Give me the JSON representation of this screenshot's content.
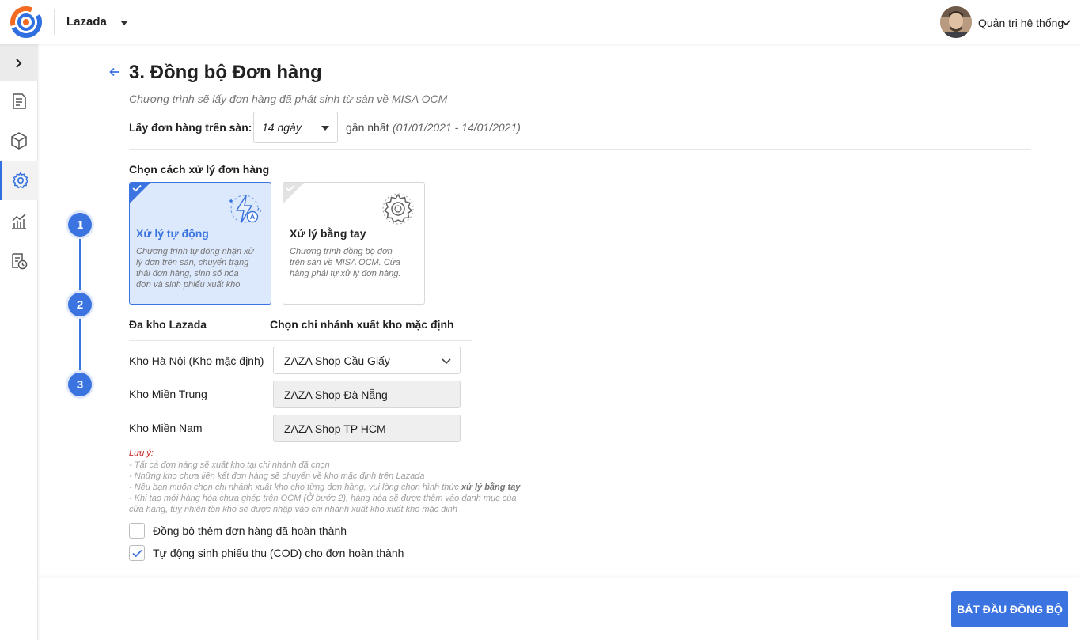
{
  "header": {
    "shop_name": "Lazada",
    "user_name": "Quản trị hệ thống",
    "icons": [
      "logo",
      "chevron-down-icon",
      "avatar"
    ]
  },
  "sidebar": {
    "items": [
      {
        "icon": "chevron-right-icon"
      },
      {
        "icon": "orders-icon"
      },
      {
        "icon": "product-box-icon"
      },
      {
        "icon": "gear-icon",
        "active": true
      },
      {
        "icon": "report-chart-icon"
      },
      {
        "icon": "history-icon"
      }
    ]
  },
  "page": {
    "title": "3. Đồng bộ Đơn hàng",
    "subtitle": "Chương trình sẽ lấy đơn hàng đã phát sinh từ sàn về MISA OCM",
    "fetch_label": "Lấy đơn hàng trên sàn:",
    "days_value": "14 ngày",
    "recent_label": "gần nhất",
    "recent_range": "(01/01/2021 - 14/01/2021)"
  },
  "steps": [
    "1",
    "2",
    "3"
  ],
  "processing": {
    "section_title": "Chọn cách xử lý đơn hàng",
    "cards": [
      {
        "title": "Xử lý tự động",
        "desc": [
          "Chương trình tự động nhận xử",
          "lý đơn trên sàn, chuyển trạng",
          "thái đơn hàng, sinh số hóa",
          "đơn và sinh phiếu xuất kho."
        ],
        "selected": true
      },
      {
        "title": "Xử lý bằng tay",
        "desc": [
          "Chương trình đồng bộ đơn",
          "trên sàn về MISA OCM. Cửa",
          "hàng phải tự xử lý đơn hàng."
        ],
        "selected": false
      }
    ]
  },
  "warehouse": {
    "col_a": "Đa kho Lazada",
    "col_b": "Chọn chi nhánh xuất kho mặc định",
    "rows": [
      {
        "label": "Kho Hà Nội (Kho mặc định)",
        "value": "ZAZA Shop Cầu Giấy"
      },
      {
        "label": "Kho Miền Trung",
        "value": "ZAZA Shop Đà Nẵng"
      },
      {
        "label": "Kho Miền Nam",
        "value": "ZAZA Shop TP HCM"
      }
    ]
  },
  "notes": {
    "title": "Lưu ý:",
    "line1": "- Tất cả đơn hàng sẽ xuất kho tại chi nhánh đã chọn",
    "line2": "- Những kho chưa liên kết đơn hàng sẽ chuyển về kho mặc định trên Lazada",
    "line3_prefix": "- Nếu bạn muốn chọn chi nhánh xuất kho cho từng đơn hàng, vui lòng chọn hình thức ",
    "line3_bold": "xử lý bằng tay",
    "line4": "- Khi tạo mới hàng hóa chưa ghép trên OCM (Ở bước 2), hàng hóa sẽ được thêm vào danh mục của",
    "line5": "cửa hàng, tuy nhiên tồn kho sẽ được nhập vào chi nhánh xuất kho xuất kho mặc định"
  },
  "options": [
    {
      "label": "Đồng bộ thêm đơn hàng đã hoàn thành",
      "checked": false
    },
    {
      "label": "Tự động sinh phiếu thu (COD) cho đơn hoàn thành",
      "checked": true
    }
  ],
  "footer": {
    "start_label": "BẮT ĐẦU ĐỒNG BỘ"
  },
  "colors": {
    "accent": "#3b74e0",
    "selected_card_bg": "#dce8fb",
    "note_title": "#c62828"
  }
}
